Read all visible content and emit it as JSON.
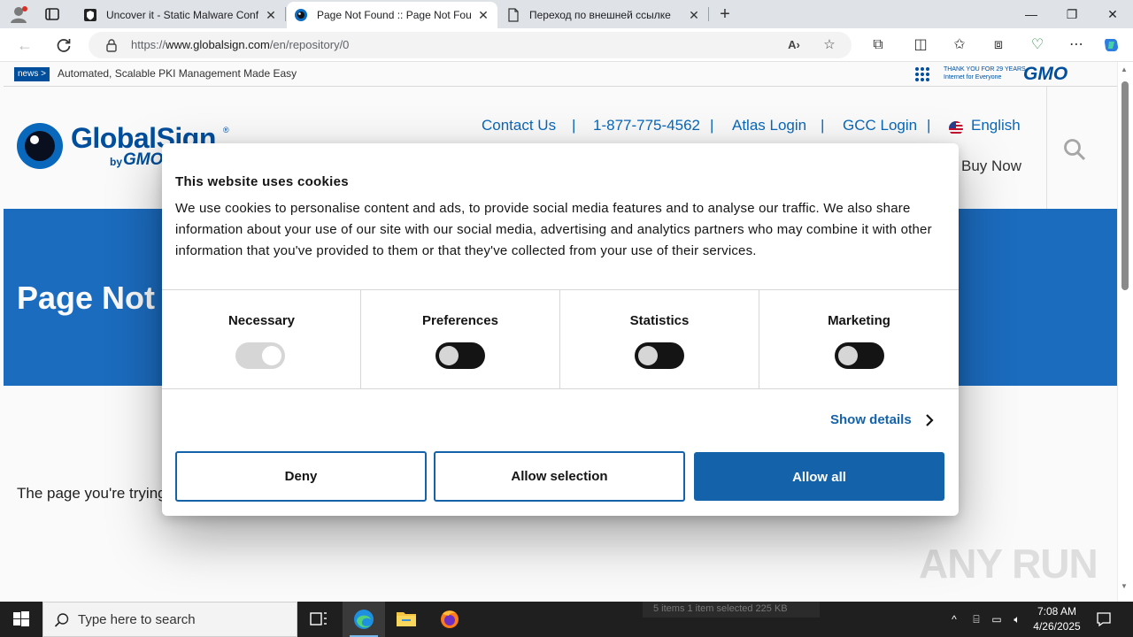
{
  "browser": {
    "tabs": [
      {
        "title": "Uncover it - Static Malware Confi",
        "active": false
      },
      {
        "title": "Page Not Found :: Page Not Foun",
        "active": true
      },
      {
        "title": "Переход по внешней ссылке",
        "active": false
      }
    ],
    "url_prefix": "https://",
    "url_host": "www.globalsign.com",
    "url_path": "/en/repository/0",
    "window_controls": {
      "minimize": "—",
      "maximize": "❐",
      "close": "✕"
    }
  },
  "page": {
    "news_badge": "news >",
    "news_text": "Automated, Scalable PKI Management Made Easy",
    "gmo_thanks": "THANK YOU FOR 29 YEARS\nInternet for Everyone",
    "gmo_logo": "GMO",
    "logo_name": "GlobalSign",
    "logo_registered": "®",
    "logo_by": "by",
    "logo_gmo": "GMO",
    "nav": {
      "contact": "Contact Us",
      "phone": "1-877-775-4562",
      "atlas": "Atlas Login",
      "gcc": "GCC Login",
      "language": "English",
      "separator": "|",
      "buy_now": "Buy Now"
    },
    "hero_title": "Page Not",
    "body_text": "The page you're trying"
  },
  "cookie_dialog": {
    "title": "This website uses cookies",
    "body": "We use cookies to personalise content and ads, to provide social media features and to analyse our traffic. We also share information about your use of our site with our social media, advertising and analytics partners who may combine it with other information that you've provided to them or that they've collected from your use of their services.",
    "categories": [
      {
        "label": "Necessary",
        "state": "disabled"
      },
      {
        "label": "Preferences",
        "state": "off"
      },
      {
        "label": "Statistics",
        "state": "off"
      },
      {
        "label": "Marketing",
        "state": "off"
      }
    ],
    "show_details": "Show details",
    "buttons": {
      "deny": "Deny",
      "allow_selection": "Allow selection",
      "allow_all": "Allow all"
    }
  },
  "taskbar": {
    "search_placeholder": "Type here to search",
    "time": "7:08 AM",
    "date": "4/26/2025",
    "ghost_status": "5 items      1 item selected  225 KB"
  },
  "watermark": "ANY RUN",
  "colors": {
    "brand_blue": "#0050a0",
    "hero_blue": "#1c6ec2",
    "cookie_accent": "#1463aa"
  }
}
